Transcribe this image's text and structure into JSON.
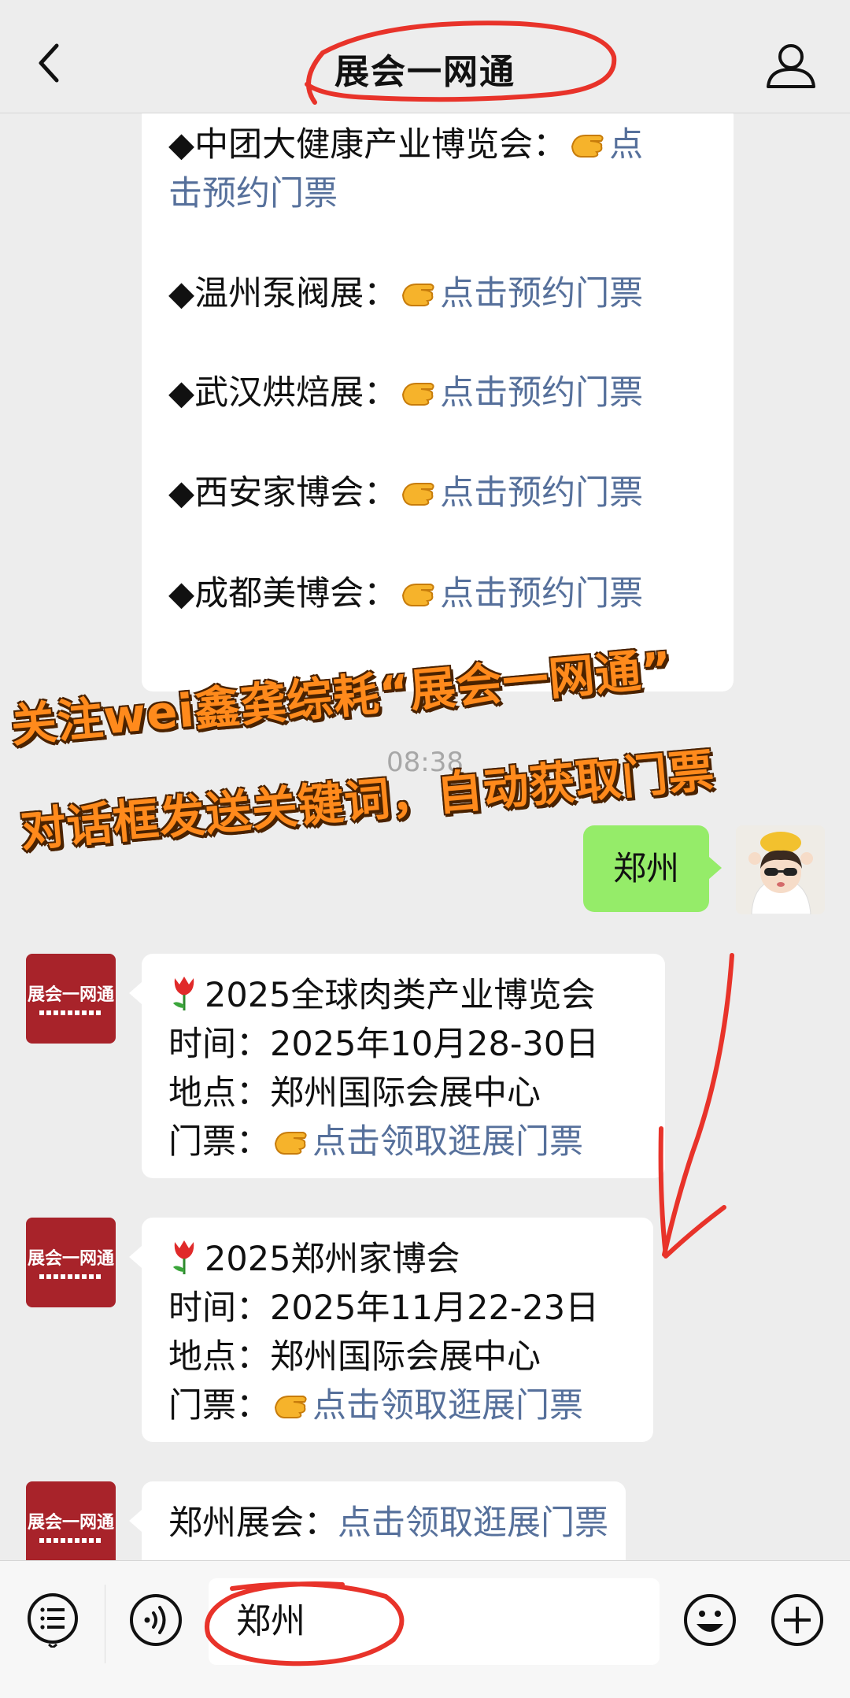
{
  "header": {
    "title": "展会一网通"
  },
  "top_bubble": {
    "items": [
      {
        "name": "◆中团大健康产业博览会：",
        "link_a": "点",
        "link_b": "击预约门票"
      },
      {
        "name": "◆温州泵阀展：",
        "link": "点击预约门票"
      },
      {
        "name": "◆武汉烘焙展：",
        "link": "点击预约门票"
      },
      {
        "name": "◆西安家博会：",
        "link": "点击预约门票"
      },
      {
        "name": "◆成都美博会：",
        "link": "点击预约门票"
      }
    ]
  },
  "timestamp": "08:38",
  "banner": {
    "line1": "关注wei鑫龚综耗“展会一网通”",
    "line2": "对话框发送关键词，自动获取门票"
  },
  "me_message": "郑州",
  "replies": [
    {
      "avatar_label": "展会一网通",
      "title": "2025全球肉类产业博览会",
      "time": "时间：2025年10月28-30日",
      "place": "地点：郑州国际会展中心",
      "ticket_prefix": "门票：",
      "ticket_link": "点击领取逛展门票"
    },
    {
      "avatar_label": "展会一网通",
      "title": "2025郑州家博会",
      "time": "时间：2025年11月22-23日",
      "place": "地点：郑州国际会展中心",
      "ticket_prefix": "门票：",
      "ticket_link": "点击领取逛展门票"
    },
    {
      "avatar_label": "展会一网通",
      "prefix": "郑州展会：",
      "link": "点击领取逛展门票"
    }
  ],
  "input": {
    "value": "郑州"
  },
  "colors": {
    "link": "#56709b",
    "my_bubble": "#95ec69",
    "banner": "#ff8a1c",
    "logo_red": "#a8232a"
  }
}
